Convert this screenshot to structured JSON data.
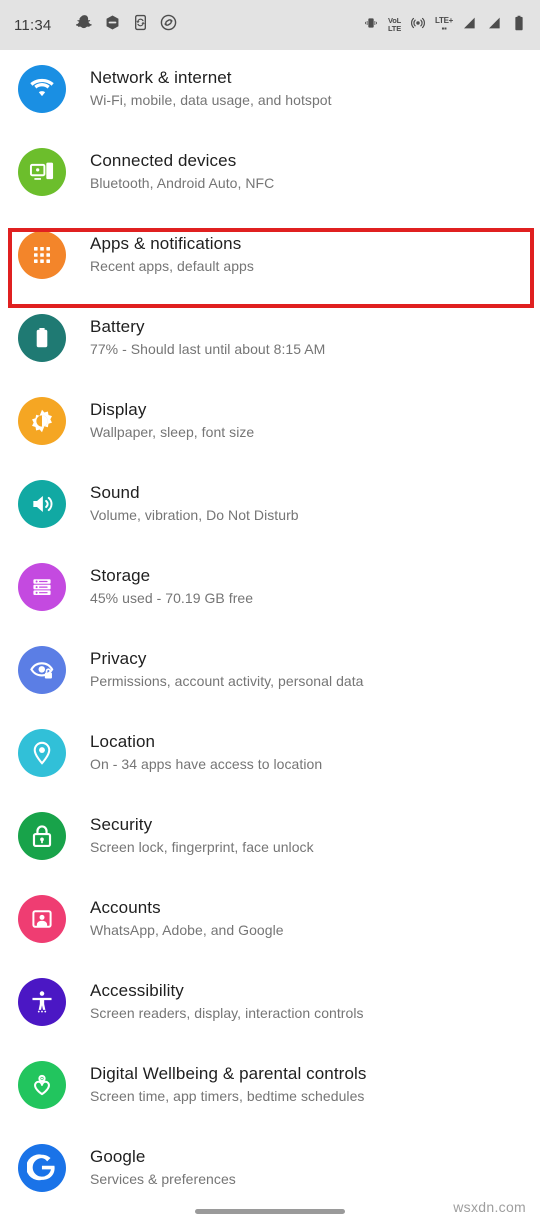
{
  "statusbar": {
    "time": "11:34",
    "left_icons": [
      {
        "name": "snapchat-icon",
        "label": "Snapchat"
      },
      {
        "name": "hexagon-app-icon",
        "label": "App"
      },
      {
        "name": "phone-sync-icon",
        "label": "Phone"
      },
      {
        "name": "shazam-icon",
        "label": "Shazam"
      }
    ],
    "right_icons": [
      {
        "name": "vibrate-icon",
        "label": "Vibrate"
      },
      {
        "name": "volte-icon",
        "label": "VoLTE"
      },
      {
        "name": "hotspot-icon",
        "label": "Hotspot"
      },
      {
        "name": "lte-plus-icon",
        "label": "LTE+"
      },
      {
        "name": "signal-sim1-icon",
        "label": "Signal 1"
      },
      {
        "name": "signal-sim2-icon",
        "label": "Signal 2"
      },
      {
        "name": "battery-icon",
        "label": "Battery"
      }
    ],
    "volte_top": "VoL",
    "volte_bottom": "LTE",
    "lte_main": "LTE+",
    "lte_sub": "▪▪"
  },
  "highlight": {
    "color": "#e02020",
    "target": "Apps & notifications"
  },
  "settings": {
    "items": [
      {
        "id": "network-internet",
        "title": "Network & internet",
        "subtitle": "Wi-Fi, mobile, data usage, and hotspot",
        "icon": "wifi-icon",
        "color": "#1a8fe3"
      },
      {
        "id": "connected-devices",
        "title": "Connected devices",
        "subtitle": "Bluetooth, Android Auto, NFC",
        "icon": "connected-devices-icon",
        "color": "#6cbe2c"
      },
      {
        "id": "apps-notifications",
        "title": "Apps & notifications",
        "subtitle": "Recent apps, default apps",
        "icon": "apps-grid-icon",
        "color": "#f3852a"
      },
      {
        "id": "battery",
        "title": "Battery",
        "subtitle": "77% - Should last until about 8:15 AM",
        "icon": "battery-full-icon",
        "color": "#1f7a73"
      },
      {
        "id": "display",
        "title": "Display",
        "subtitle": "Wallpaper, sleep, font size",
        "icon": "brightness-icon",
        "color": "#f5a623"
      },
      {
        "id": "sound",
        "title": "Sound",
        "subtitle": "Volume, vibration, Do Not Disturb",
        "icon": "speaker-icon",
        "color": "#11a9a3"
      },
      {
        "id": "storage",
        "title": "Storage",
        "subtitle": "45% used - 70.19 GB free",
        "icon": "storage-stack-icon",
        "color": "#c44ae0"
      },
      {
        "id": "privacy",
        "title": "Privacy",
        "subtitle": "Permissions, account activity, personal data",
        "icon": "privacy-eye-lock-icon",
        "color": "#5b7ee5"
      },
      {
        "id": "location",
        "title": "Location",
        "subtitle": "On - 34 apps have access to location",
        "icon": "location-pin-icon",
        "color": "#31c0d8"
      },
      {
        "id": "security",
        "title": "Security",
        "subtitle": "Screen lock, fingerprint, face unlock",
        "icon": "lock-icon",
        "color": "#18a34a"
      },
      {
        "id": "accounts",
        "title": "Accounts",
        "subtitle": "WhatsApp, Adobe, and Google",
        "icon": "account-card-icon",
        "color": "#ef3d72"
      },
      {
        "id": "accessibility",
        "title": "Accessibility",
        "subtitle": "Screen readers, display, interaction controls",
        "icon": "accessibility-person-icon",
        "color": "#4b17c4"
      },
      {
        "id": "digital-wellbeing",
        "title": "Digital Wellbeing & parental controls",
        "subtitle": "Screen time, app timers, bedtime schedules",
        "icon": "wellbeing-heart-icon",
        "color": "#22c55e"
      },
      {
        "id": "google",
        "title": "Google",
        "subtitle": "Services & preferences",
        "icon": "google-g-icon",
        "color": "#1a73e8"
      }
    ]
  },
  "footer": {
    "watermark": "wsxdn.com",
    "nav_pill": "home-gesture-pill"
  }
}
